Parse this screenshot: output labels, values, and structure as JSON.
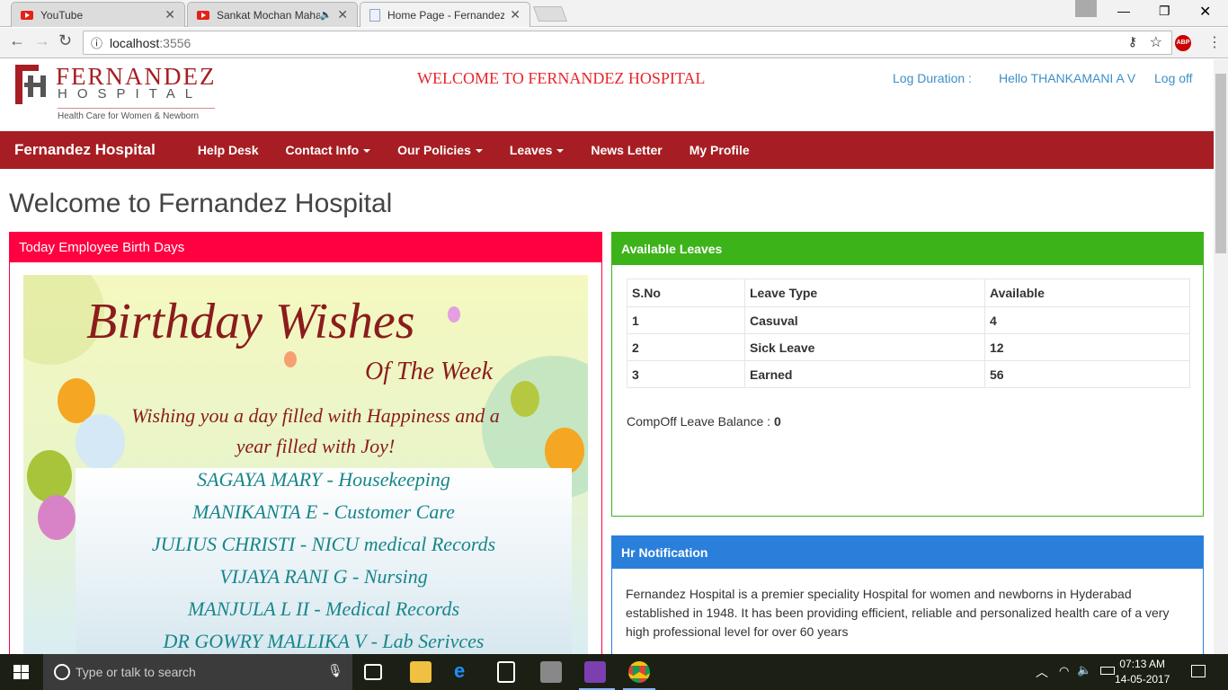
{
  "browser": {
    "tabs": [
      {
        "title": "YouTube"
      },
      {
        "title": "Sankat Mochan Maha"
      },
      {
        "title": "Home Page - Fernandez"
      }
    ],
    "url_host": "localhost",
    "url_port": ":3556"
  },
  "header": {
    "logo_name": "FERNANDEZ",
    "logo_sub": "HOSPITAL",
    "logo_tagline": "Health Care for Women & Newborn",
    "welcome": "WELCOME TO FERNANDEZ HOSPITAL",
    "log_duration": "Log Duration :",
    "hello": "Hello THANKAMANI A V",
    "logoff": "Log off"
  },
  "nav": {
    "brand": "Fernandez Hospital",
    "items": [
      {
        "label": "Help Desk"
      },
      {
        "label": "Contact Info"
      },
      {
        "label": "Our Policies"
      },
      {
        "label": "Leaves"
      },
      {
        "label": "News Letter"
      },
      {
        "label": "My Profile"
      }
    ]
  },
  "page_title": "Welcome to Fernandez Hospital",
  "birthdays": {
    "title": "Today Employee Birth Days",
    "banner_title": "Birthday Wishes",
    "banner_sub": "Of The Week",
    "banner_wish": "Wishing you a day filled with Happiness and a year filled with Joy!",
    "names": [
      "SAGAYA MARY - Housekeeping",
      "MANIKANTA E - Customer Care",
      "JULIUS CHRISTI - NICU medical Records",
      "VIJAYA RANI G - Nursing",
      "MANJULA L II - Medical Records",
      "DR GOWRY MALLIKA V - Lab Serivces"
    ]
  },
  "leaves": {
    "title": "Available Leaves",
    "headers": [
      "S.No",
      "Leave Type",
      "Available"
    ],
    "rows": [
      [
        "1",
        "Casuval",
        "4"
      ],
      [
        "2",
        "Sick Leave",
        "12"
      ],
      [
        "3",
        "Earned",
        "56"
      ]
    ],
    "compoff_label": "CompOff Leave Balance :",
    "compoff_value": "0"
  },
  "hr": {
    "title": "Hr Notification",
    "text": "Fernandez Hospital is a premier speciality Hospital for women and newborns in Hyderabad established in 1948. It has been providing efficient, reliable and personalized health care of a very high professional level for over 60 years"
  },
  "taskbar": {
    "search_placeholder": "Type or talk to search",
    "time": "07:13 AM",
    "date": "14-05-2017"
  }
}
